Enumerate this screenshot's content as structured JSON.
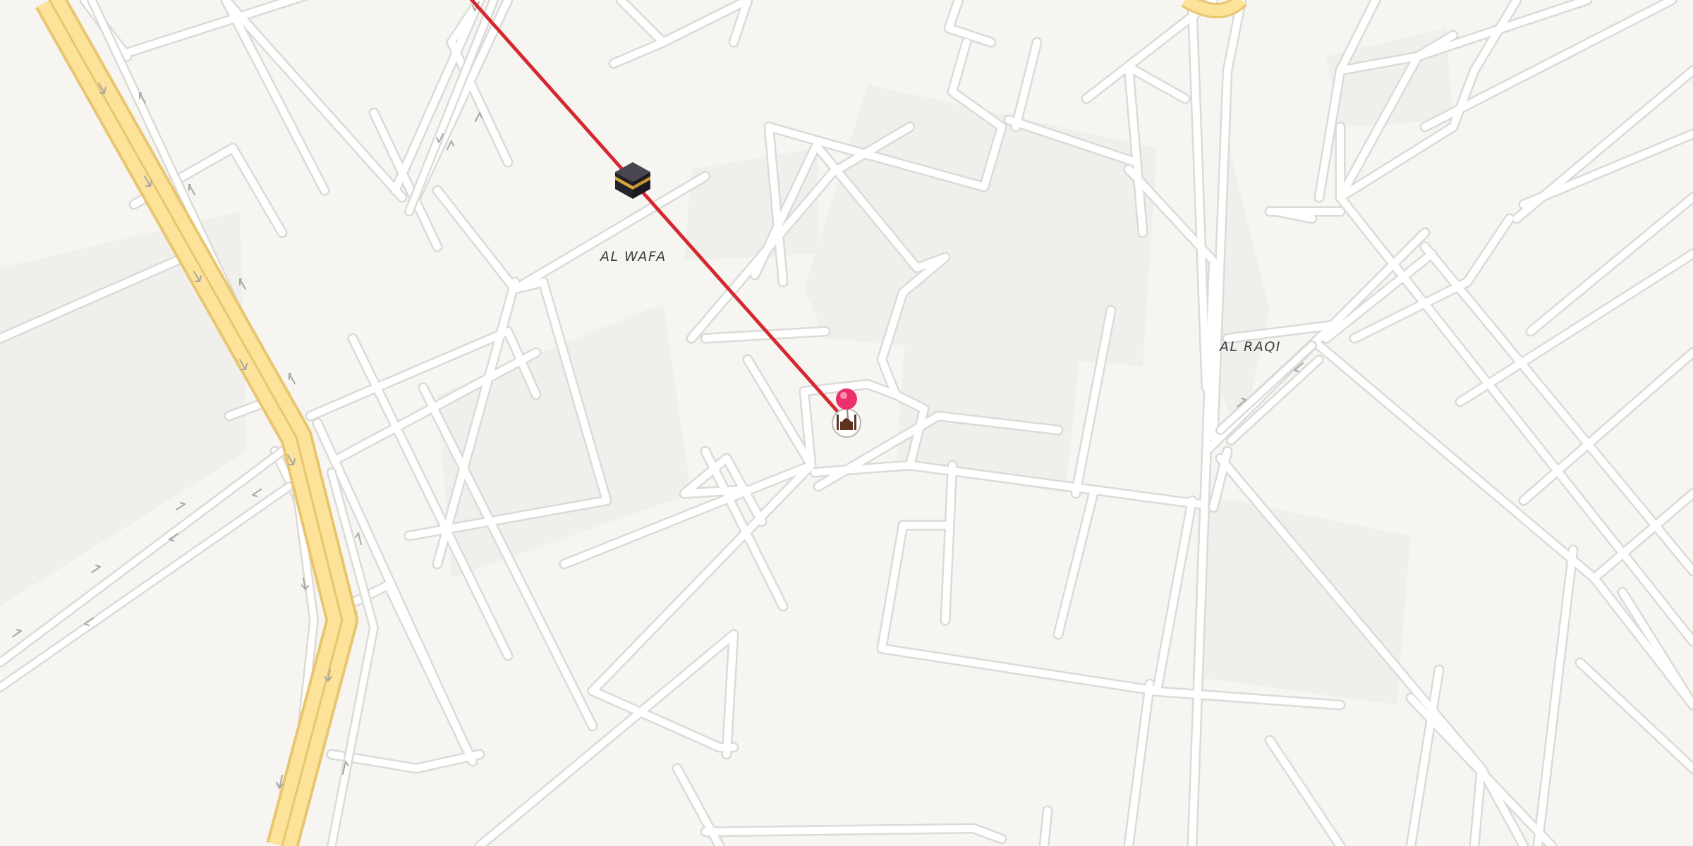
{
  "map": {
    "districts": [
      {
        "id": "al-wafa",
        "label": "AL WAFA"
      },
      {
        "id": "al-raqi",
        "label": "AL RAQI"
      }
    ],
    "route": {
      "color": "#d42a2f",
      "from": "kaaba-marker",
      "to": "mosque-marker"
    },
    "markers": [
      {
        "id": "kaaba",
        "icon": "kaaba-icon"
      },
      {
        "id": "mosque",
        "icon": "mosque-icon"
      },
      {
        "id": "location-pin",
        "icon": "location-pin-icon",
        "color": "#ee2f6d"
      }
    ],
    "colors": {
      "background": "#f7f5f2",
      "block": "#f1efec",
      "street": "#ffffff",
      "street_casing": "#dcdad6",
      "highway": "#fde39a",
      "highway_casing": "#e9c56f"
    }
  }
}
